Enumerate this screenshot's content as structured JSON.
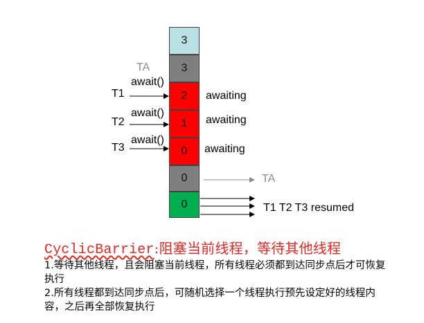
{
  "stack": [
    {
      "value": "3",
      "color": "#b9e0e3"
    },
    {
      "value": "3",
      "color": "#7f7f7f"
    },
    {
      "value": "2",
      "color": "#ff0000"
    },
    {
      "value": "1",
      "color": "#ff0000"
    },
    {
      "value": "0",
      "color": "#ff0000"
    },
    {
      "value": "0",
      "color": "#7f7f7f"
    },
    {
      "value": "0",
      "color": "#00b050"
    }
  ],
  "labels": {
    "ta_top": "TA",
    "await1": "await()",
    "await2": "await()",
    "await3": "await()",
    "t1": "T1",
    "t2": "T2",
    "t3": "T3",
    "awaiting1": "awaiting",
    "awaiting2": "awaiting",
    "awaiting3": "awaiting",
    "ta_right": "TA",
    "resumed": "T1 T2 T3 resumed"
  },
  "heading": {
    "mono": "CyclicBarrier",
    "cn": ":阻塞当前线程，等待其他线程"
  },
  "paragraphs": {
    "p1_num": "1.",
    "p1_text": "等待其他线程，且会阻塞当前线程，所有线程必须都到达同步点后才可恢复执行",
    "p2_num": "2.",
    "p2_text": "所有线程都到达同步点后，可随机选择一个线程执行预先设定好的线程内容，之后再全部恢复执行"
  },
  "colors": {
    "heading": "#e0281f",
    "arrow_gray": "#8c8c8c"
  }
}
